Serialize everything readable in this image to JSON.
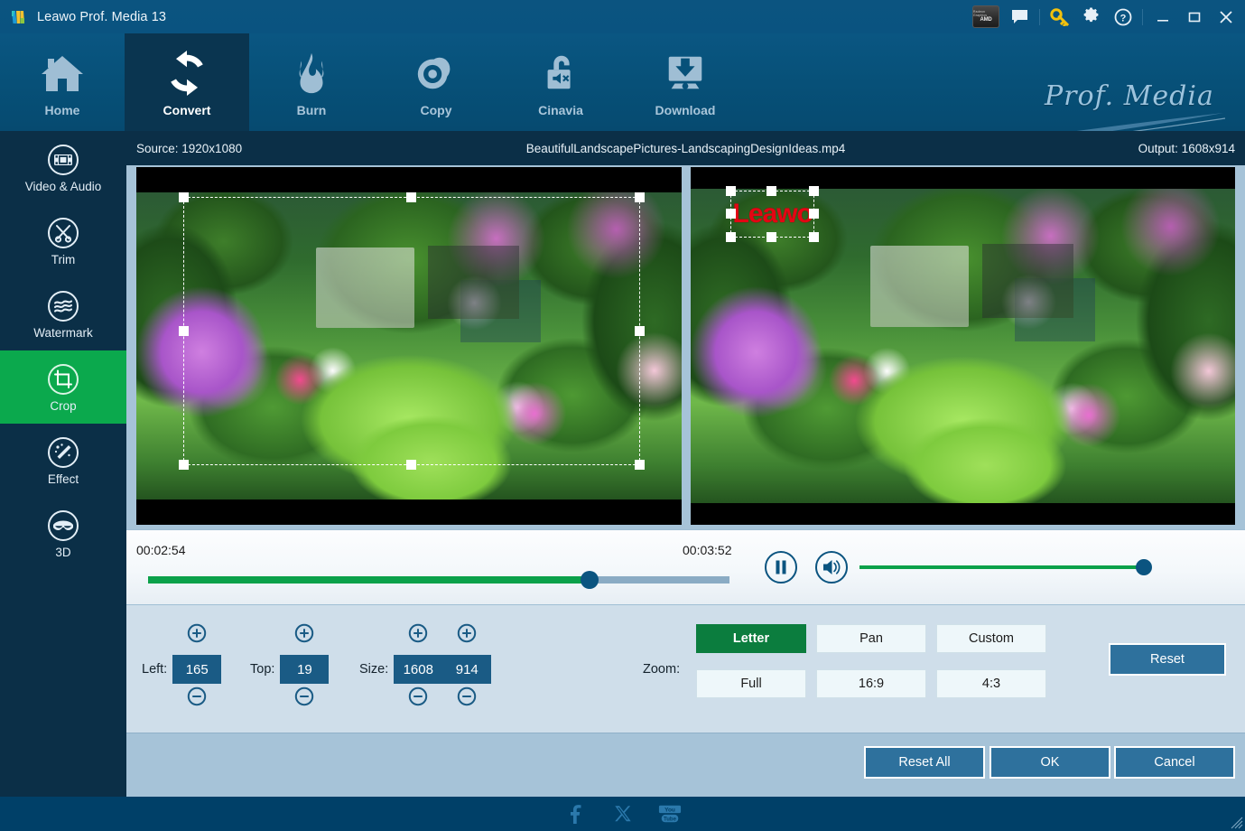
{
  "window": {
    "title": "Leawo Prof. Media 13",
    "logo_icon": "leawo-logo-icon",
    "controls": {
      "amd_badge_line1": "Radeon Graphics",
      "amd_badge_line2": "AMD",
      "feedback_icon": "speech-bubble-icon",
      "key_icon": "key-icon",
      "settings_icon": "gear-icon",
      "help_icon": "question-mark-icon",
      "minimize_icon": "minimize-icon",
      "maximize_icon": "maximize-icon",
      "close_icon": "close-icon"
    }
  },
  "nav": {
    "items": [
      {
        "label": "Home",
        "icon": "home-icon",
        "active": false
      },
      {
        "label": "Convert",
        "icon": "convert-icon",
        "active": true
      },
      {
        "label": "Burn",
        "icon": "flame-icon",
        "active": false
      },
      {
        "label": "Copy",
        "icon": "disc-icon",
        "active": false
      },
      {
        "label": "Cinavia",
        "icon": "unlock-mute-icon",
        "active": false
      },
      {
        "label": "Download",
        "icon": "download-icon",
        "active": false
      }
    ],
    "brand": "Prof. Media"
  },
  "sidebar": {
    "items": [
      {
        "label": "Video & Audio",
        "icon": "film-strip-icon",
        "active": false
      },
      {
        "label": "Trim",
        "icon": "scissors-icon",
        "active": false
      },
      {
        "label": "Watermark",
        "icon": "waves-icon",
        "active": false
      },
      {
        "label": "Crop",
        "icon": "crop-icon",
        "active": true
      },
      {
        "label": "Effect",
        "icon": "magic-wand-icon",
        "active": false
      },
      {
        "label": "3D",
        "icon": "3d-glasses-icon",
        "active": false
      }
    ]
  },
  "info_bar": {
    "source": "Source: 1920x1080",
    "file_name": "BeautifulLandscapePictures-LandscapingDesignIdeas.mp4",
    "output": "Output: 1608x914"
  },
  "preview": {
    "left_label": "source-preview",
    "right_label": "output-preview",
    "watermark_text": "Leawo"
  },
  "player": {
    "current_time": "00:02:54",
    "total_time": "00:03:52",
    "seek_percent": 76,
    "volume_percent": 96,
    "pause_icon": "pause-icon",
    "volume_icon": "speaker-icon"
  },
  "crop": {
    "left_label": "Left:",
    "left_value": "165",
    "top_label": "Top:",
    "top_value": "19",
    "size_label": "Size:",
    "size_width": "1608",
    "size_height": "914",
    "zoom_label": "Zoom:",
    "zoom_presets": [
      {
        "label": "Letter",
        "active": true
      },
      {
        "label": "Pan",
        "active": false
      },
      {
        "label": "Custom",
        "active": false
      },
      {
        "label": "Full",
        "active": false
      },
      {
        "label": "16:9",
        "active": false
      },
      {
        "label": "4:3",
        "active": false
      }
    ],
    "reset_label": "Reset",
    "plus_icon": "plus-circle-icon",
    "minus_icon": "minus-circle-icon"
  },
  "actions": {
    "reset_all": "Reset All",
    "ok": "OK",
    "cancel": "Cancel"
  },
  "footer": {
    "social": [
      {
        "name": "facebook-icon"
      },
      {
        "name": "x-twitter-icon"
      },
      {
        "name": "youtube-icon"
      }
    ]
  },
  "colors": {
    "titlebar": "#0b5480",
    "navbar": "#075179",
    "sidebar": "#0b2f47",
    "accent_green": "#0ba94d",
    "panel": "#cfdeea",
    "action_bar": "#a6c3d8",
    "footer": "#004068",
    "button_blue": "#2e719d",
    "field_blue": "#1a5b85",
    "watermark_red": "#e30613"
  }
}
